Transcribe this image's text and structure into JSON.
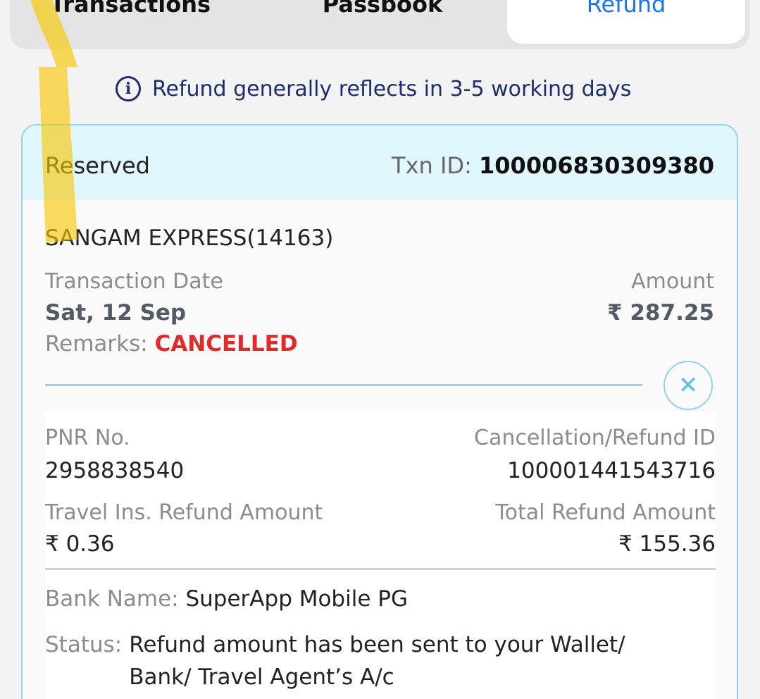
{
  "tabs": [
    {
      "label": "Transactions"
    },
    {
      "label": "Passbook"
    },
    {
      "label": "Refund"
    }
  ],
  "info": {
    "icon": "info-icon",
    "icon_glyph": "i",
    "text": "Refund generally reflects in 3-5 working days"
  },
  "card": {
    "category": "Reserved",
    "txn_label": "Txn ID: ",
    "txn_id": "100006830309380",
    "train": "SANGAM EXPRESS(14163)",
    "txn_date_label": "Transaction Date",
    "txn_date": "Sat, 12 Sep",
    "amount_label": "Amount",
    "amount": "₹ 287.25",
    "remarks_label": "Remarks: ",
    "remarks": "CANCELLED",
    "close_glyph": "✕",
    "pnr_label": "PNR No.",
    "pnr": "2958838540",
    "cancel_id_label": "Cancellation/Refund ID",
    "cancel_id": "100001441543716",
    "ins_label": "Travel Ins. Refund Amount",
    "ins_amount": "₹ 0.36",
    "total_label": "Total Refund Amount",
    "total_amount": "₹ 155.36",
    "bank_label": "Bank Name: ",
    "bank": "SuperApp Mobile PG",
    "status_label": "Status: ",
    "status": "Refund amount has been sent to your Wallet/ Bank/ Travel Agent’s A/c"
  },
  "colors": {
    "accent": "#1a73e8",
    "card_border": "#8fd2ea",
    "header_bg": "#e0f7fd",
    "cancelled": "#e02b2b",
    "info_text": "#1c2f6b",
    "highlighter": "#f8c600"
  }
}
